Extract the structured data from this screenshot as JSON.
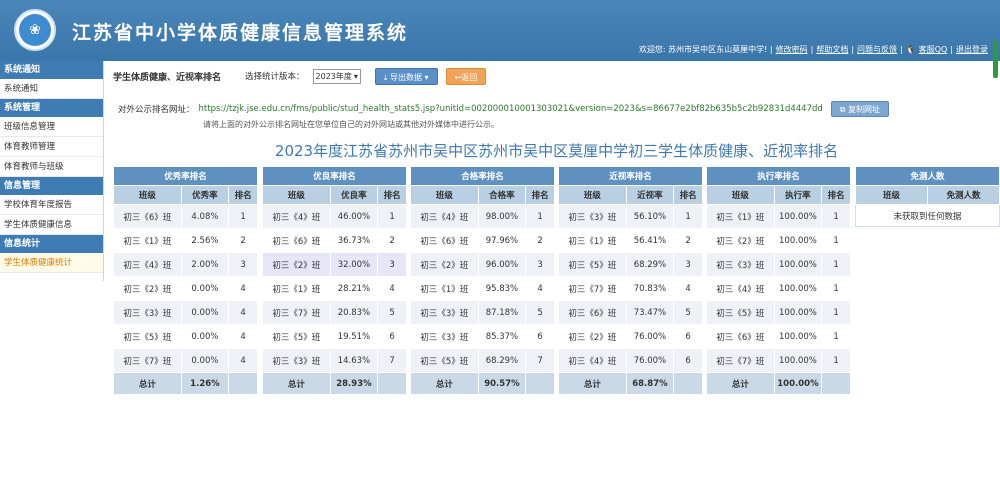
{
  "header": {
    "system_title": "江苏省中小学体质健康信息管理系统",
    "welcome": "欢迎您: 苏州市吴中区东山莫厘中学! |",
    "links": [
      "修改密码",
      "帮助文档",
      "问题与反馈"
    ],
    "separators": [
      "|",
      "|",
      "|"
    ],
    "qq_label": "客服QQ",
    "logout": "退出登录"
  },
  "sidebar": [
    {
      "group": "系统通知",
      "items": [
        {
          "label": "系统通知",
          "active": false
        }
      ]
    },
    {
      "group": "系统管理",
      "items": [
        {
          "label": "班级信息管理",
          "active": false
        },
        {
          "label": "体育教师管理",
          "active": false
        },
        {
          "label": "体育教师与班级",
          "active": false
        }
      ]
    },
    {
      "group": "信息管理",
      "items": [
        {
          "label": "学校体育年度报告",
          "active": false
        },
        {
          "label": "学生体质健康信息",
          "active": false
        }
      ]
    },
    {
      "group": "信息统计",
      "items": [
        {
          "label": "学生体质健康统计",
          "active": true
        }
      ]
    }
  ],
  "toolbar": {
    "page_title": "学生体质健康、近视率排名",
    "version_label": "选择统计版本：",
    "version_value": "2023年度",
    "export_label": "导出数据",
    "back_label": "返回"
  },
  "public_url": {
    "label": "对外公示排名网址：",
    "value": "https://tzjk.jse.edu.cn/fms/public/stud_health_stats5.jsp?unitId=002000010001303021&version=2023&s=86677e2bf82b635b5c2b92831d4447dd",
    "copy_label": "复制网址",
    "hint": "请将上面的对外公示排名网址在您单位自己的对外网站或其他对外媒体中进行公示。"
  },
  "report_title": "2023年度江苏省苏州市吴中区苏州市吴中区莫厘中学初三学生体质健康、近视率排名",
  "tables": [
    {
      "caption": "优秀率排名",
      "cols": [
        "班级",
        "优秀率",
        "排名"
      ],
      "rows": [
        [
          "初三《6》班",
          "4.08%",
          "1"
        ],
        [
          "初三《1》班",
          "2.56%",
          "2"
        ],
        [
          "初三《4》班",
          "2.00%",
          "3"
        ],
        [
          "初三《2》班",
          "0.00%",
          "4"
        ],
        [
          "初三《3》班",
          "0.00%",
          "4"
        ],
        [
          "初三《5》班",
          "0.00%",
          "4"
        ],
        [
          "初三《7》班",
          "0.00%",
          "4"
        ]
      ],
      "total": [
        "总计",
        "1.26%",
        ""
      ]
    },
    {
      "caption": "优良率排名",
      "cols": [
        "班级",
        "优良率",
        "排名"
      ],
      "rows": [
        [
          "初三《4》班",
          "46.00%",
          "1"
        ],
        [
          "初三《6》班",
          "36.73%",
          "2"
        ],
        [
          "初三《2》班",
          "32.00%",
          "3"
        ],
        [
          "初三《1》班",
          "28.21%",
          "4"
        ],
        [
          "初三《7》班",
          "20.83%",
          "5"
        ],
        [
          "初三《5》班",
          "19.51%",
          "6"
        ],
        [
          "初三《3》班",
          "14.63%",
          "7"
        ]
      ],
      "total": [
        "总计",
        "28.93%",
        ""
      ],
      "highlight_row": 2
    },
    {
      "caption": "合格率排名",
      "cols": [
        "班级",
        "合格率",
        "排名"
      ],
      "rows": [
        [
          "初三《4》班",
          "98.00%",
          "1"
        ],
        [
          "初三《6》班",
          "97.96%",
          "2"
        ],
        [
          "初三《2》班",
          "96.00%",
          "3"
        ],
        [
          "初三《1》班",
          "95.83%",
          "4"
        ],
        [
          "初三《3》班",
          "87.18%",
          "5"
        ],
        [
          "初三《3》班",
          "85.37%",
          "6"
        ],
        [
          "初三《5》班",
          "68.29%",
          "7"
        ]
      ],
      "total": [
        "总计",
        "90.57%",
        ""
      ]
    },
    {
      "caption": "近视率排名",
      "cols": [
        "班级",
        "近视率",
        "排名"
      ],
      "rows": [
        [
          "初三《3》班",
          "56.10%",
          "1"
        ],
        [
          "初三《1》班",
          "56.41%",
          "2"
        ],
        [
          "初三《5》班",
          "68.29%",
          "3"
        ],
        [
          "初三《7》班",
          "70.83%",
          "4"
        ],
        [
          "初三《6》班",
          "73.47%",
          "5"
        ],
        [
          "初三《2》班",
          "76.00%",
          "6"
        ],
        [
          "初三《4》班",
          "76.00%",
          "6"
        ]
      ],
      "total": [
        "总计",
        "68.87%",
        ""
      ]
    },
    {
      "caption": "执行率排名",
      "cols": [
        "班级",
        "执行率",
        "排名"
      ],
      "rows": [
        [
          "初三《1》班",
          "100.00%",
          "1"
        ],
        [
          "初三《2》班",
          "100.00%",
          "1"
        ],
        [
          "初三《3》班",
          "100.00%",
          "1"
        ],
        [
          "初三《4》班",
          "100.00%",
          "1"
        ],
        [
          "初三《5》班",
          "100.00%",
          "1"
        ],
        [
          "初三《6》班",
          "100.00%",
          "1"
        ],
        [
          "初三《7》班",
          "100.00%",
          "1"
        ]
      ],
      "total": [
        "总计",
        "100.00%",
        ""
      ]
    },
    {
      "caption": "免测人数",
      "cols": [
        "班级",
        "免测人数"
      ],
      "empty_text": "未获取到任何数据"
    }
  ]
}
